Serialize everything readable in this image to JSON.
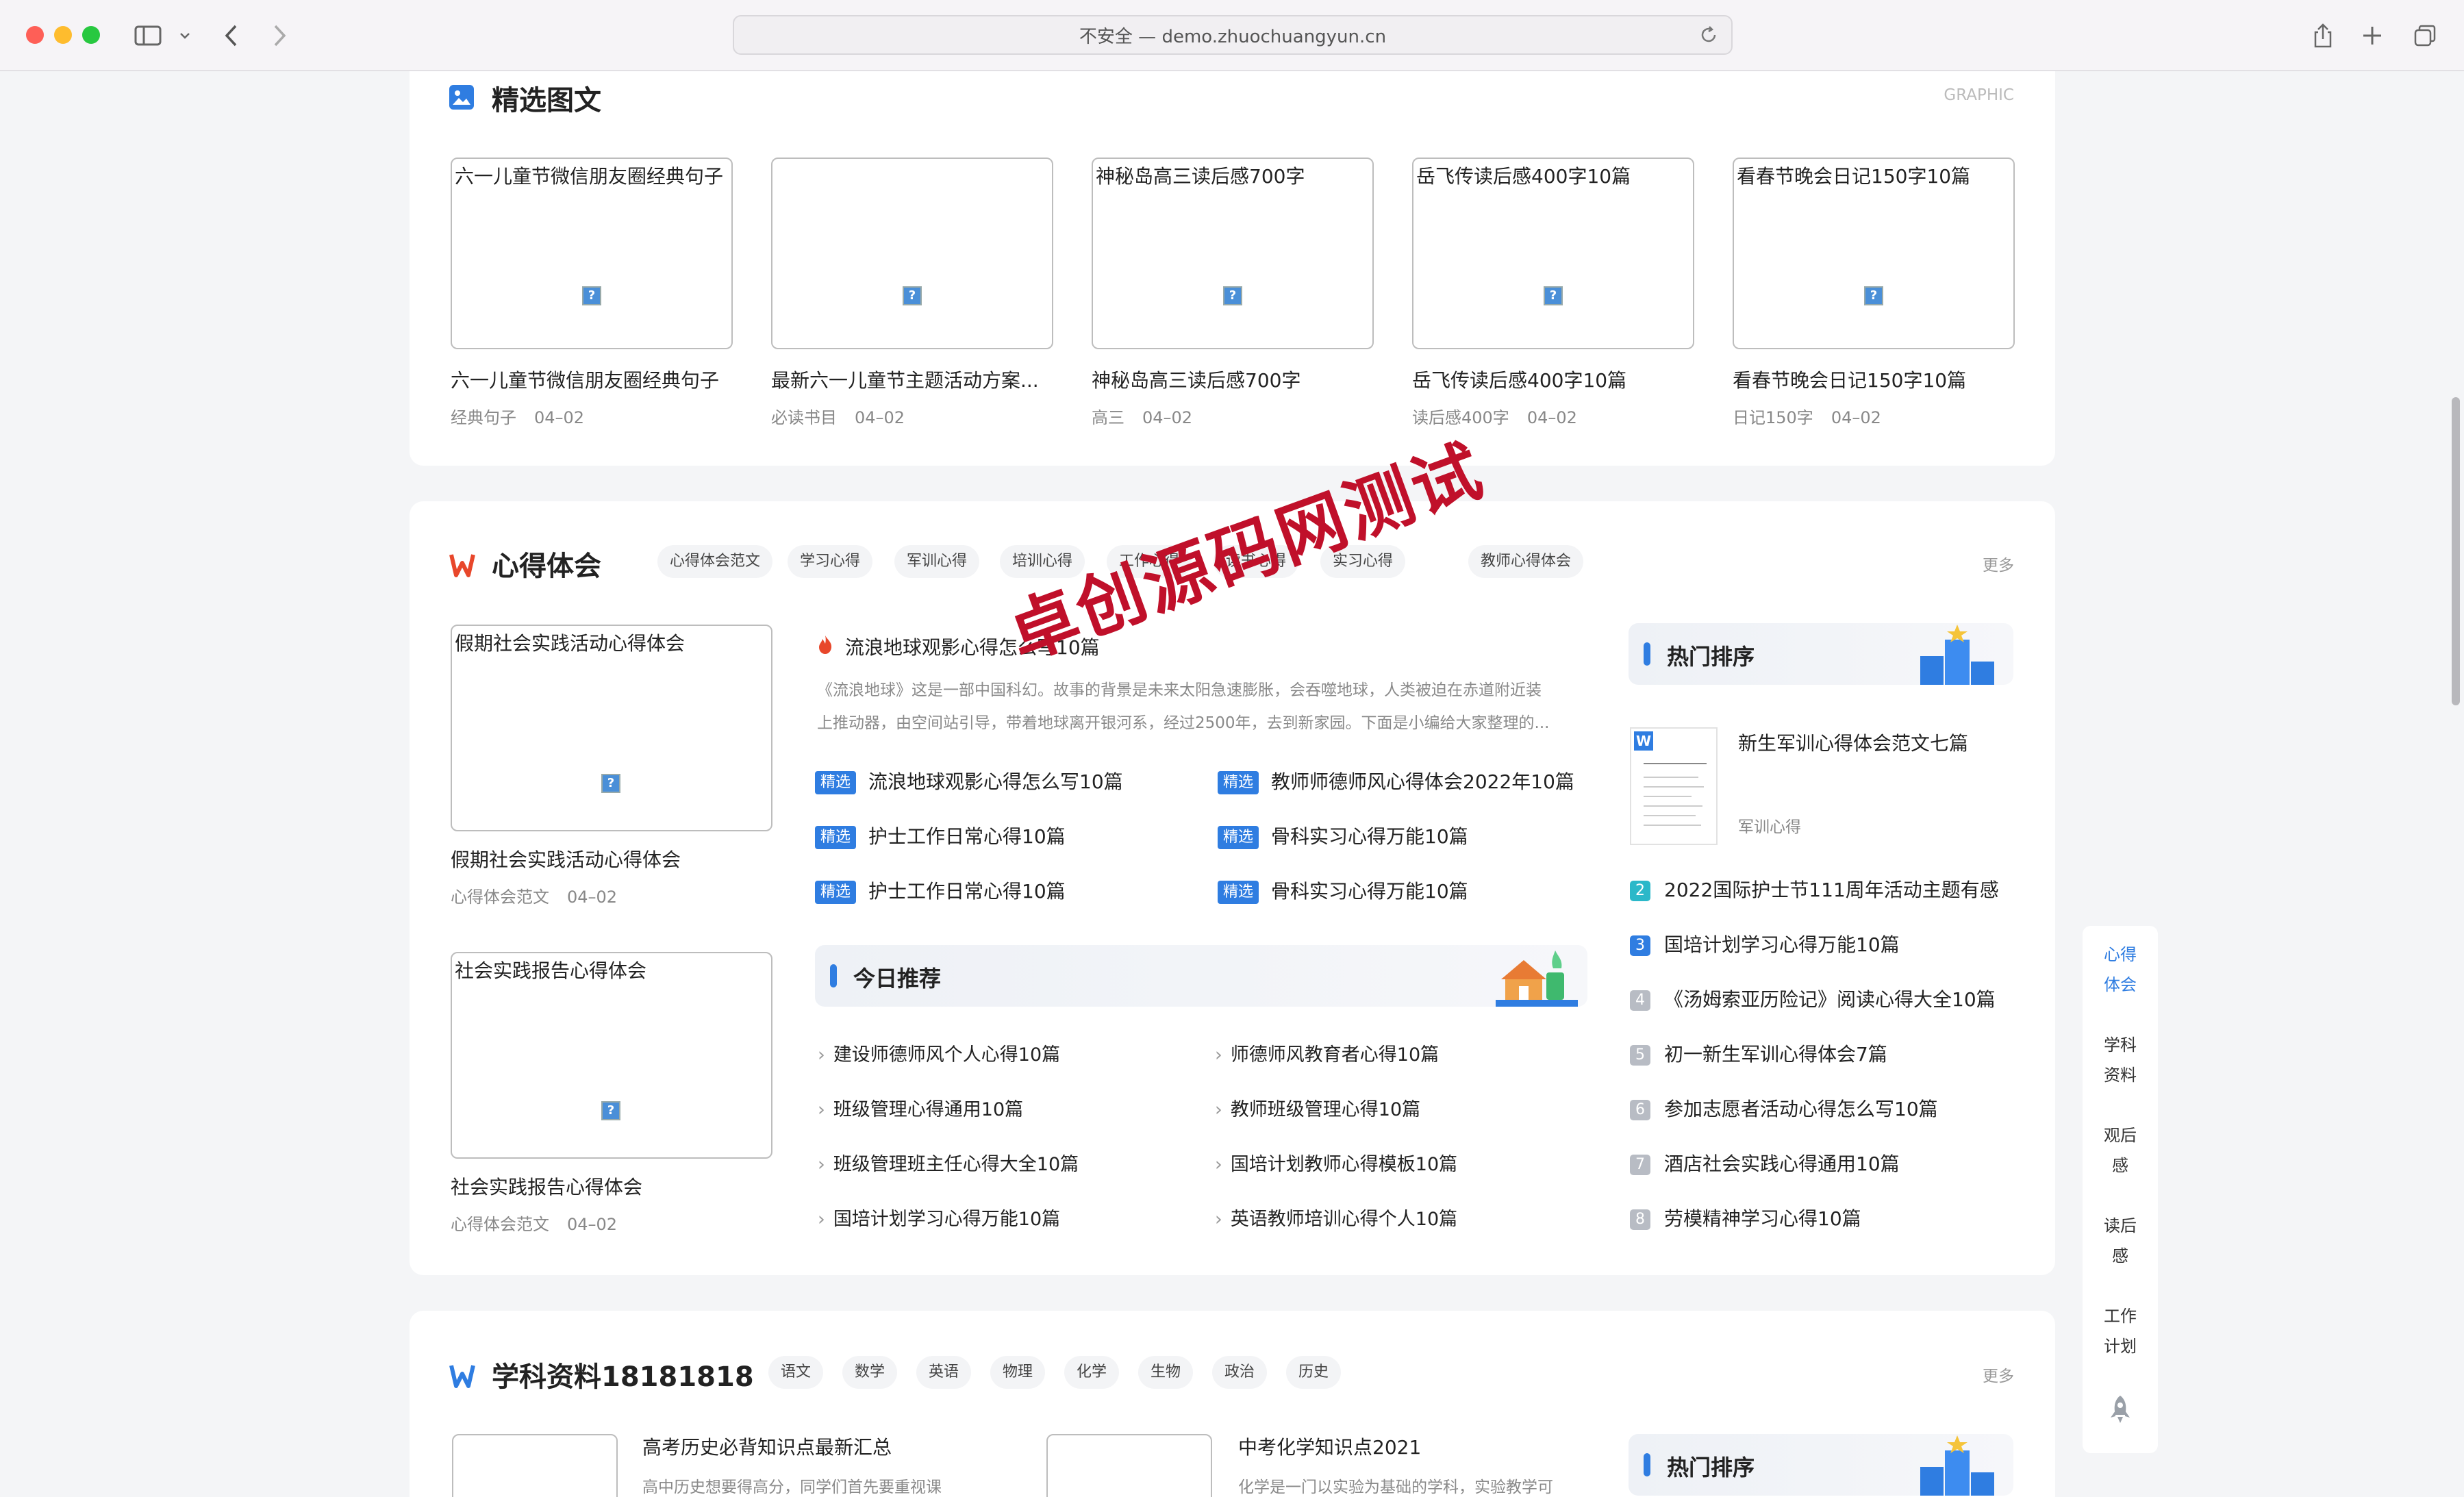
{
  "browser": {
    "url_display": "不安全 — demo.zhuochuangyun.cn"
  },
  "graphic": {
    "title": "精选图文",
    "label": "GRAPHIC",
    "items": [
      {
        "alt": "六一儿童节微信朋友圈经典句子",
        "title": "六一儿童节微信朋友圈经典句子",
        "tag": "经典句子",
        "date": "04–02"
      },
      {
        "alt": "",
        "title": "最新六一儿童节主题活动方案...",
        "tag": "必读书目",
        "date": "04–02"
      },
      {
        "alt": "神秘岛高三读后感700字",
        "title": "神秘岛高三读后感700字",
        "tag": "高三",
        "date": "04–02"
      },
      {
        "alt": "岳飞传读后感400字10篇",
        "title": "岳飞传读后感400字10篇",
        "tag": "读后感400字",
        "date": "04–02"
      },
      {
        "alt": "看春节晚会日记150字10篇",
        "title": "看春节晚会日记150字10篇",
        "tag": "日记150字",
        "date": "04–02"
      }
    ]
  },
  "xinde": {
    "title": "心得体会",
    "more": "更多",
    "tags": [
      "心得体会范文",
      "学习心得",
      "军训心得",
      "培训心得",
      "工作心得",
      "读书心得",
      "实习心得",
      "教师心得体会"
    ],
    "left": [
      {
        "alt": "假期社会实践活动心得体会",
        "title": "假期社会实践活动心得体会",
        "tag": "心得体会范文",
        "date": "04–02"
      },
      {
        "alt": "社会实践报告心得体会",
        "title": "社会实践报告心得体会",
        "tag": "心得体会范文",
        "date": "04–02"
      }
    ],
    "headline": {
      "title": "流浪地球观影心得怎么写10篇",
      "summary1": "《流浪地球》这是一部中国科幻。故事的背景是未来太阳急速膨胀，会吞噬地球，人类被迫在赤道附近装",
      "summary2": "上推动器，由空间站引导，带着地球离开银河系，经过2500年，去到新家园。下面是小编给大家整理的..."
    },
    "badge": "精选",
    "featured": [
      "流浪地球观影心得怎么写10篇",
      "教师师德师风心得体会2022年10篇",
      "护士工作日常心得10篇",
      "骨科实习心得万能10篇",
      "护士工作日常心得10篇",
      "骨科实习心得万能10篇"
    ],
    "today_title": "今日推荐",
    "today": [
      "建设师德师风个人心得10篇",
      "师德师风教育者心得10篇",
      "班级管理心得通用10篇",
      "教师班级管理心得10篇",
      "班级管理班主任心得大全10篇",
      "国培计划教师心得模板10篇",
      "国培计划学习心得万能10篇",
      "英语教师培训心得个人10篇"
    ],
    "hot_title": "热门排序",
    "hot_top": {
      "title": "新生军训心得体会范文七篇",
      "tag": "军训心得"
    },
    "ranks": [
      {
        "n": "2",
        "title": "2022国际护士节111周年活动主题有感"
      },
      {
        "n": "3",
        "title": "国培计划学习心得万能10篇"
      },
      {
        "n": "4",
        "title": "《汤姆索亚历险记》阅读心得大全10篇"
      },
      {
        "n": "5",
        "title": "初一新生军训心得体会7篇"
      },
      {
        "n": "6",
        "title": "参加志愿者活动心得怎么写10篇"
      },
      {
        "n": "7",
        "title": "酒店社会实践心得通用10篇"
      },
      {
        "n": "8",
        "title": "劳模精神学习心得10篇"
      }
    ]
  },
  "xueke": {
    "title": "学科资料18181818",
    "more": "更多",
    "tags": [
      "语文",
      "数学",
      "英语",
      "物理",
      "化学",
      "生物",
      "政治",
      "历史"
    ],
    "items": [
      {
        "title": "高考历史必背知识点最新汇总",
        "summary": "高中历史想要得高分，同学们首先要重视课"
      },
      {
        "title": "中考化学知识点2021",
        "summary": "化学是一门以实验为基础的学科，实验教学可"
      }
    ],
    "hot_title": "热门排序"
  },
  "sidenav": {
    "items": [
      {
        "l1": "心得",
        "l2": "体会"
      },
      {
        "l1": "学科",
        "l2": "资料"
      },
      {
        "l1": "观后",
        "l2": "感"
      },
      {
        "l1": "读后",
        "l2": "感"
      },
      {
        "l1": "工作",
        "l2": "计划"
      }
    ]
  },
  "watermark": "卓创源码网测试",
  "colors": {
    "accent": "#2f7de1",
    "watermark": "#c0102a",
    "flame": "#e8472b"
  }
}
